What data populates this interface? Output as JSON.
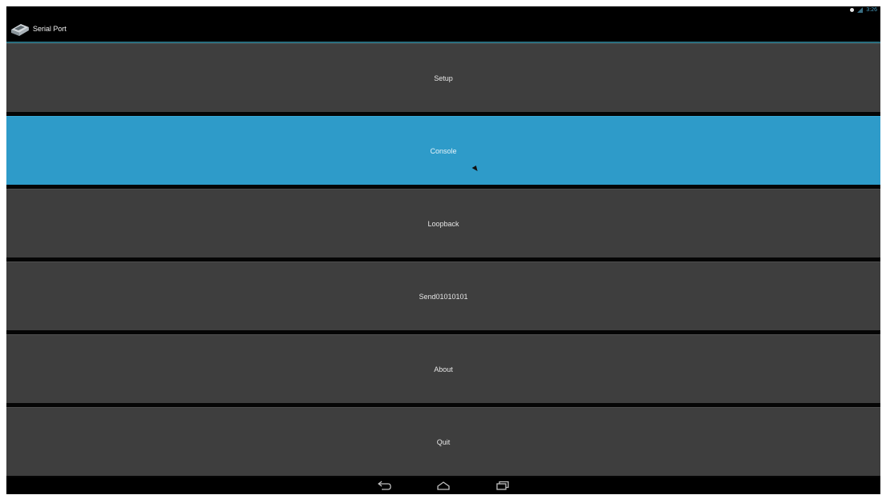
{
  "status_bar": {
    "time": "3:26",
    "icons": [
      "notification-dot-icon",
      "signal-icon"
    ]
  },
  "action_bar": {
    "app_icon": "serial-port-app-icon",
    "title": "Serial Port"
  },
  "menu": {
    "selected_index": 1,
    "selected_color": "#2e9bc9",
    "button_color": "#3e3e3e",
    "items": [
      {
        "label": "Setup"
      },
      {
        "label": "Console"
      },
      {
        "label": "Loopback"
      },
      {
        "label": "Send01010101"
      },
      {
        "label": "About"
      },
      {
        "label": "Quit"
      }
    ]
  },
  "nav_bar": {
    "icons": [
      "back-icon",
      "home-icon",
      "recent-apps-icon"
    ]
  }
}
